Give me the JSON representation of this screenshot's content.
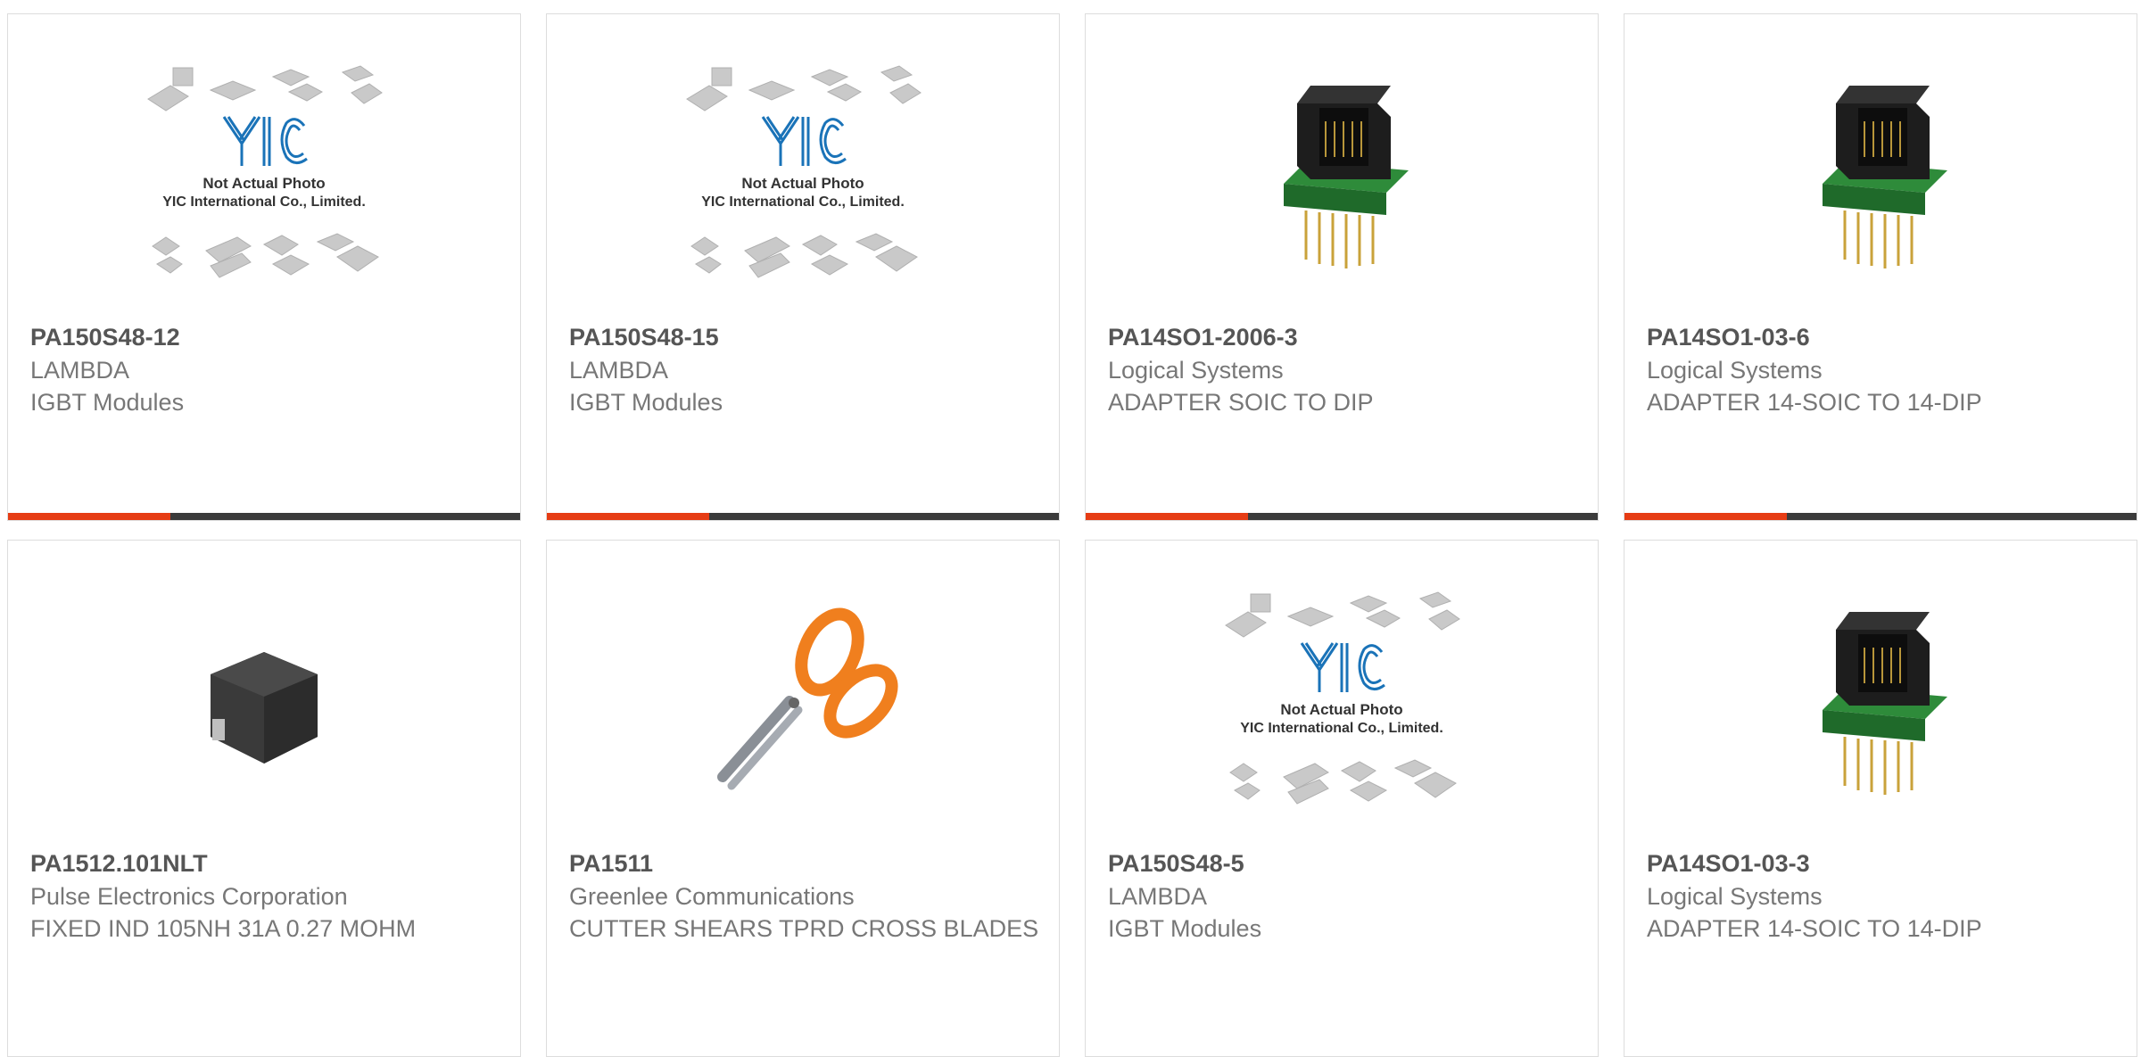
{
  "colors": {
    "accent": "#e63c14",
    "bar": "#3b3b3b",
    "border": "#dddddd"
  },
  "placeholder": {
    "line1": "Not Actual Photo",
    "line2": "YIC International Co., Limited."
  },
  "products": [
    {
      "part": "PA150S48-12",
      "manufacturer": "LAMBDA",
      "description": "IGBT Modules",
      "image": "placeholder-image"
    },
    {
      "part": "PA150S48-15",
      "manufacturer": "LAMBDA",
      "description": "IGBT Modules",
      "image": "placeholder-image"
    },
    {
      "part": "PA14SO1-2006-3",
      "manufacturer": "Logical Systems",
      "description": "ADAPTER SOIC TO DIP",
      "image": "socket-adapter-image"
    },
    {
      "part": "PA14SO1-03-6",
      "manufacturer": "Logical Systems",
      "description": "ADAPTER 14-SOIC TO 14-DIP",
      "image": "socket-adapter-image"
    },
    {
      "part": "PA1512.101NLT",
      "manufacturer": "Pulse Electronics Corporation",
      "description": "FIXED IND 105NH 31A 0.27 MOHM",
      "image": "inductor-image"
    },
    {
      "part": "PA1511",
      "manufacturer": "Greenlee Communications",
      "description": "CUTTER SHEARS TPRD CROSS BLADES",
      "image": "scissors-image"
    },
    {
      "part": "PA150S48-5",
      "manufacturer": "LAMBDA",
      "description": "IGBT Modules",
      "image": "placeholder-image"
    },
    {
      "part": "PA14SO1-03-3",
      "manufacturer": "Logical Systems",
      "description": "ADAPTER 14-SOIC TO 14-DIP",
      "image": "socket-adapter-image"
    }
  ]
}
